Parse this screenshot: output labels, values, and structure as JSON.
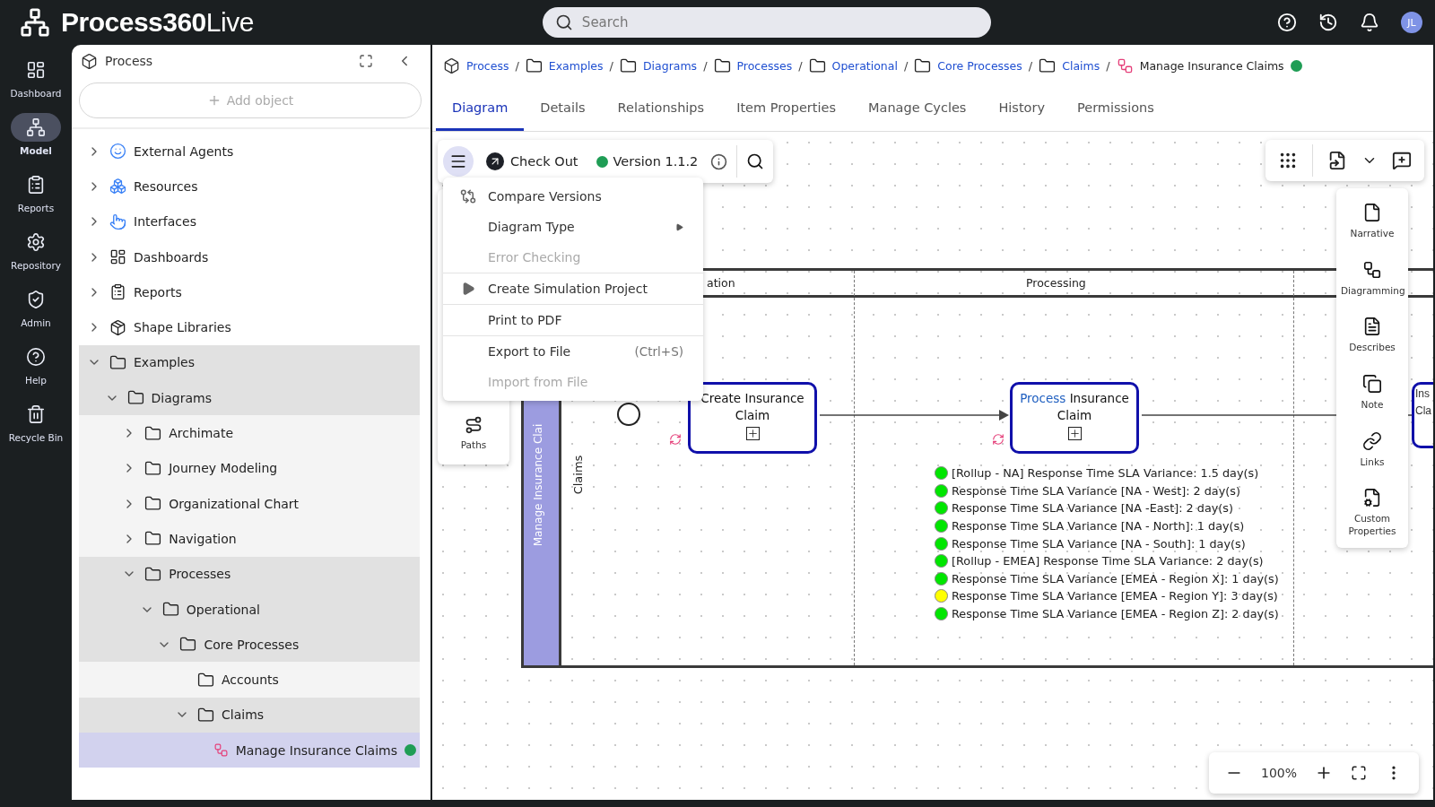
{
  "app": {
    "logo": "**Process360**Live",
    "search": {
      "placeholder": "Search"
    },
    "avatar": "JL"
  },
  "nav": [
    {
      "kind": "dashboard",
      "label": "Dashboard",
      "selected": false
    },
    {
      "kind": "model",
      "label": "Model",
      "selected": true
    },
    {
      "kind": "reports",
      "label": "Reports",
      "selected": false
    },
    {
      "kind": "repository",
      "label": "Repository",
      "selected": false
    },
    {
      "kind": "admin",
      "label": "Admin",
      "selected": false
    },
    {
      "kind": "help",
      "label": "Help",
      "selected": false
    },
    {
      "kind": "recycle",
      "label": "Recycle Bin",
      "selected": false
    }
  ],
  "panel": {
    "title": "Process",
    "add_placeholder": "Add object",
    "tree": [
      {
        "label": "External Agents",
        "kind": "agents",
        "expanded": false,
        "selected": false
      },
      {
        "label": "Resources",
        "kind": "resources",
        "expanded": false,
        "selected": false
      },
      {
        "label": "Interfaces",
        "kind": "interfaces",
        "expanded": false,
        "selected": false
      },
      {
        "label": "Dashboards",
        "kind": "dashboards",
        "expanded": false,
        "selected": false
      },
      {
        "label": "Reports",
        "kind": "reports",
        "expanded": false,
        "selected": false
      },
      {
        "label": "Shape Libraries",
        "kind": "library",
        "expanded": false,
        "selected": false
      },
      {
        "label": "Examples",
        "kind": "folder",
        "expanded": true,
        "selected": false,
        "children": [
          {
            "label": "Diagrams",
            "kind": "folder",
            "expanded": true,
            "selected": false,
            "children": [
              {
                "label": "Archimate",
                "kind": "folder",
                "expanded": false,
                "selected": false
              },
              {
                "label": "Journey Modeling",
                "kind": "folder",
                "expanded": false,
                "selected": false
              },
              {
                "label": "Organizational Chart",
                "kind": "folder",
                "expanded": false,
                "selected": false
              },
              {
                "label": "Navigation",
                "kind": "folder",
                "expanded": false,
                "selected": false
              },
              {
                "label": "Processes",
                "kind": "folder",
                "expanded": true,
                "selected": false,
                "children": [
                  {
                    "label": "Operational",
                    "kind": "folder",
                    "expanded": true,
                    "selected": false,
                    "children": [
                      {
                        "label": "Core Processes",
                        "kind": "folder",
                        "expanded": true,
                        "selected": false,
                        "children": [
                          {
                            "label": "Accounts",
                            "kind": "folder",
                            "selected": false
                          },
                          {
                            "label": "Claims",
                            "kind": "folder",
                            "expanded": true,
                            "selected": false,
                            "children": [
                              {
                                "label": "Manage Insurance Claims",
                                "kind": "diagram",
                                "selected": true,
                                "color": "#1f9d55"
                              }
                            ]
                          }
                        ]
                      }
                    ]
                  }
                ]
              }
            ]
          }
        ]
      }
    ]
  },
  "breadcrumb": [
    {
      "label": "Process",
      "kind": "cube",
      "current": false
    },
    {
      "separator": "/",
      "label": "Examples",
      "kind": "folder",
      "current": false
    },
    {
      "separator": "/",
      "label": "Diagrams",
      "kind": "folder",
      "current": false
    },
    {
      "separator": "/",
      "label": "Processes",
      "kind": "folder",
      "current": false
    },
    {
      "separator": "/",
      "label": "Operational",
      "kind": "folder",
      "current": false
    },
    {
      "separator": "/",
      "label": "Core Processes",
      "kind": "folder",
      "current": false
    },
    {
      "separator": "/",
      "label": "Claims",
      "kind": "folder",
      "current": false
    },
    {
      "separator": "/",
      "label": "Manage Insurance Claims",
      "kind": "diagram",
      "current": true,
      "color": "#1f9d55"
    }
  ],
  "tabs": [
    {
      "label": "Diagram",
      "selected": true
    },
    {
      "label": "Details",
      "selected": false
    },
    {
      "label": "Relationships",
      "selected": false
    },
    {
      "label": "Item Properties",
      "selected": false
    },
    {
      "label": "Manage Cycles",
      "selected": false
    },
    {
      "label": "History",
      "selected": false
    },
    {
      "label": "Permissions",
      "selected": false
    }
  ],
  "toolbar": {
    "menu_open": true,
    "checkout": "Check Out",
    "version": {
      "label": "Version 1.1.2",
      "color": "#1f9d55"
    }
  },
  "menu": [
    [
      {
        "label": "Compare Versions",
        "kind": "compare",
        "disabled": false
      },
      {
        "label": "Diagram Type",
        "submenu": true,
        "disabled": false
      },
      {
        "label": "Error Checking",
        "disabled": true
      }
    ],
    [
      {
        "label": "Create Simulation Project",
        "kind": "simulation",
        "disabled": false
      }
    ],
    [
      {
        "label": "Print to PDF",
        "disabled": false
      }
    ],
    [
      {
        "label": "Export to File",
        "shortcut": "(Ctrl+S)",
        "disabled": false
      },
      {
        "label": "Import from File",
        "disabled": true
      }
    ]
  ],
  "paths_panel": {
    "label": "Paths"
  },
  "diagram": {
    "pool": "Manage Insurance Clai",
    "lane": "Claims",
    "phases": [
      {
        "label": "ation"
      },
      {
        "label": "Processing"
      }
    ],
    "tasks": [
      {
        "parts": [
          {
            "text": "Create Insurance Claim"
          }
        ]
      },
      {
        "parts": [
          {
            "text": "Process",
            "link": true
          },
          {
            "text": " Insurance Claim"
          }
        ]
      }
    ],
    "cut_task": [
      "Ins",
      "Cla"
    ],
    "metrics": [
      {
        "text": "[Rollup - NA] Response Time SLA Variance: 1.5 day(s)",
        "color": "#00e600"
      },
      {
        "text": "Response Time SLA Variance [NA - West]: 2 day(s)",
        "color": "#00e600"
      },
      {
        "text": "Response Time SLA Variance [NA -East]: 2 day(s)",
        "color": "#00e600"
      },
      {
        "text": "Response Time SLA Variance [NA - North]: 1 day(s)",
        "color": "#00e600"
      },
      {
        "text": "Response Time SLA Variance [NA - South]: 1 day(s)",
        "color": "#00e600"
      },
      {
        "text": "[Rollup - EMEA] Response Time SLA Variance: 2 day(s)",
        "color": "#00e600"
      },
      {
        "text": "Response Time SLA Variance [EMEA - Region X]: 1 day(s)",
        "color": "#00e600"
      },
      {
        "text": "Response Time SLA Variance [EMEA - Region Y]: 3 day(s)",
        "color": "#ffff00"
      },
      {
        "text": "Response Time SLA Variance [EMEA - Region Z]: 2 day(s)",
        "color": "#00e600"
      }
    ]
  },
  "side_tools": [
    {
      "kind": "narrative",
      "label": "Narrative"
    },
    {
      "kind": "diagramming",
      "label": "Diagramming"
    },
    {
      "kind": "describes",
      "label": "Describes"
    },
    {
      "kind": "note",
      "label": "Note"
    },
    {
      "kind": "links",
      "label": "Links"
    },
    {
      "kind": "custom",
      "label": "Custom Properties"
    }
  ],
  "zoom": {
    "value": "100%"
  }
}
